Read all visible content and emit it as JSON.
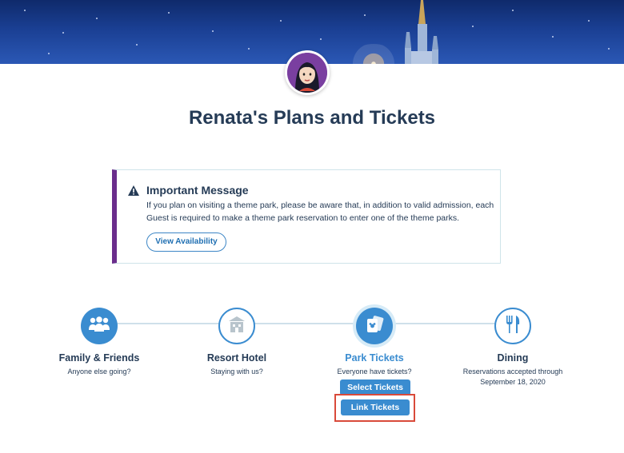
{
  "header": {
    "page_title": "Renata's Plans and Tickets"
  },
  "message": {
    "title": "Important Message",
    "body": "If you plan on visiting a theme park, please be aware that, in addition to valid admission, each Guest is required to make a theme park reservation to enter one of the theme parks.",
    "button_label": "View Availability",
    "accent_color": "#6b2d8c"
  },
  "steps": [
    {
      "title": "Family & Friends",
      "subtitle": "Anyone else going?",
      "icon": "family-icon",
      "state": "complete"
    },
    {
      "title": "Resort Hotel",
      "subtitle": "Staying with us?",
      "icon": "hotel-icon",
      "state": "incomplete"
    },
    {
      "title": "Park Tickets",
      "subtitle": "Everyone have tickets?",
      "icon": "ticket-icon",
      "state": "active"
    },
    {
      "title": "Dining",
      "subtitle": "Reservations accepted through September 18, 2020",
      "icon": "dining-icon",
      "state": "incomplete"
    }
  ],
  "ticket_actions": {
    "select_label": "Select Tickets",
    "link_label": "Link Tickets"
  },
  "colors": {
    "primary_blue": "#3a8cd0",
    "text_navy": "#253b56",
    "highlight_red": "#d94a3a"
  }
}
